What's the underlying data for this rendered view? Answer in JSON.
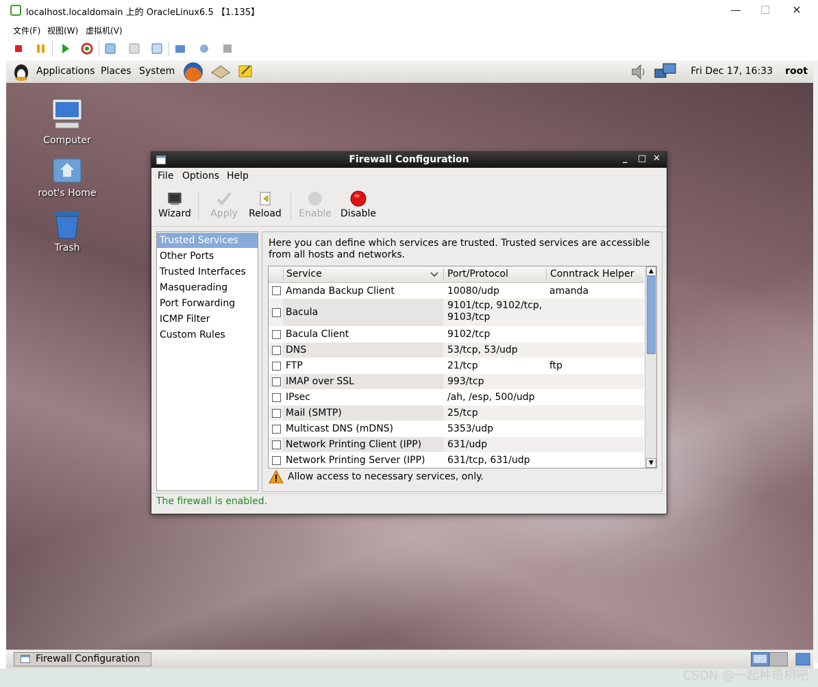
{
  "host": {
    "title": "localhost.localdomain 上的 OracleLinux6.5 【1.135】",
    "window_controls": {
      "minimize": "—",
      "maximize": "☐",
      "close": "✕"
    },
    "menu": [
      "文件(F)",
      "视图(W)",
      "虚拟机(V)"
    ],
    "toolbar_icons": [
      "stop-icon",
      "pause-icon",
      "play-icon",
      "refresh-icon",
      "snapshot-icon",
      "revert-icon",
      "manage-snapshots-icon",
      "send-ctrl-alt-del-icon",
      "settings-icon",
      "tools-icon"
    ]
  },
  "panel": {
    "menus": [
      "Applications",
      "Places",
      "System"
    ],
    "clock": "Fri Dec 17, 16:33",
    "user": "root"
  },
  "desktop": {
    "icons": [
      "Computer",
      "root's Home",
      "Trash"
    ]
  },
  "firewall": {
    "title": "Firewall Configuration",
    "menu": [
      "File",
      "Options",
      "Help"
    ],
    "toolbar": {
      "wizard": "Wizard",
      "apply": "Apply",
      "reload": "Reload",
      "enable": "Enable",
      "disable": "Disable"
    },
    "sidebar": [
      "Trusted Services",
      "Other Ports",
      "Trusted Interfaces",
      "Masquerading",
      "Port Forwarding",
      "ICMP Filter",
      "Custom Rules"
    ],
    "description": "Here you can define which services are trusted. Trusted services are accessible from all hosts and networks.",
    "columns": [
      "Service",
      "Port/Protocol",
      "Conntrack Helper"
    ],
    "services": [
      {
        "name": "Amanda Backup Client",
        "port": "10080/udp",
        "helper": "amanda"
      },
      {
        "name": "Bacula",
        "port": "9101/tcp, 9102/tcp, 9103/tcp",
        "helper": ""
      },
      {
        "name": "Bacula Client",
        "port": "9102/tcp",
        "helper": ""
      },
      {
        "name": "DNS",
        "port": "53/tcp, 53/udp",
        "helper": ""
      },
      {
        "name": "FTP",
        "port": "21/tcp",
        "helper": "ftp"
      },
      {
        "name": "IMAP over SSL",
        "port": "993/tcp",
        "helper": ""
      },
      {
        "name": "IPsec",
        "port": "/ah, /esp, 500/udp",
        "helper": ""
      },
      {
        "name": "Mail (SMTP)",
        "port": "25/tcp",
        "helper": ""
      },
      {
        "name": "Multicast DNS (mDNS)",
        "port": "5353/udp",
        "helper": ""
      },
      {
        "name": "Network Printing Client (IPP)",
        "port": "631/udp",
        "helper": ""
      },
      {
        "name": "Network Printing Server (IPP)",
        "port": "631/tcp, 631/udp",
        "helper": ""
      }
    ],
    "warning": "Allow access to necessary services, only.",
    "status": "The firewall is enabled."
  },
  "taskbar": {
    "item": "Firewall Configuration"
  },
  "watermark": "CSDN @一起种梧桐吧"
}
